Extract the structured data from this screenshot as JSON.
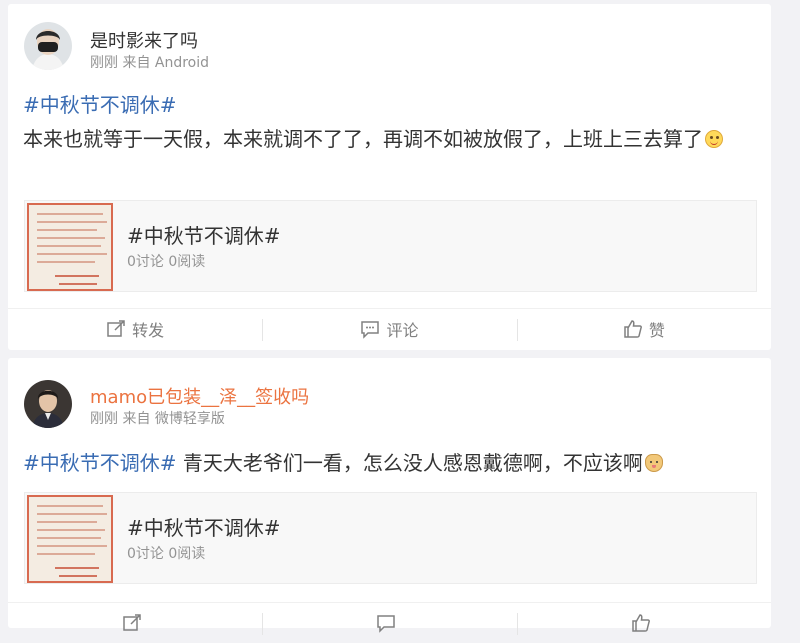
{
  "posts": [
    {
      "username": "是时影来了吗",
      "meta": "刚刚 来自 Android",
      "hashtag": "#中秋节不调休#",
      "text": "本来也就等于一天假，本来就调不了了，再调不如被放假了，上班上三去算了",
      "emoji": "smile-emoji",
      "embed": {
        "title": "#中秋节不调休#",
        "meta": "0讨论 0阅读"
      },
      "actions": {
        "repost": "转发",
        "comment": "评论",
        "like": "赞"
      }
    },
    {
      "username": "mamo已包装__泽__签收吗",
      "username_color": "#eb7340",
      "meta": "刚刚 来自 微博轻享版",
      "hashtag": "#中秋节不调休#",
      "text": " 青天大老爷们一看，怎么没人感恩戴德啊，不应该啊",
      "emoji": "doge-emoji",
      "embed": {
        "title": "#中秋节不调休#",
        "meta": "0讨论 0阅读"
      }
    }
  ],
  "colors": {
    "hashtag": "#3a6cb3",
    "background": "#f2f2f5",
    "orange_name": "#eb7340"
  }
}
